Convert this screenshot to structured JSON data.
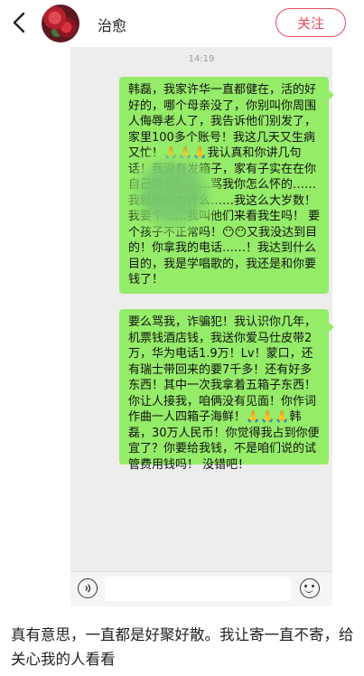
{
  "header": {
    "username": "治愈",
    "follow_label": "关注"
  },
  "chat": {
    "time": "14:19",
    "messages": [
      "韩磊，我家许华一直都健在，活的好好的，哪个母亲没了，你别叫你周围人侮辱老人了，我告诉他们别发了，家里100多个账号！我这几天又生病又忙！🙏🙏🙏我认真和你讲几句话！我没有发箱子，家有子实在在你自己听！！……骂我你怎么怀的……我就纳闷为什么……我这么大岁数！我要个……我叫他们来看我生吗！ 要个孩子不正常吗！😶😶又我没达到目的！你拿我的电话……！我达到什么目的，我是学唱歌的，我还是和你要钱了！",
      "要么骂我，诈骗犯！我认识你几年，机票钱酒店钱，我送你爱马仕皮带2万，华为电话1.9万！Lv！蒙口，还有瑞士带回来的要7千多！还有好多东西！其中一次我拿着五箱子东西！你让人接我，咱俩没有见面！你作词作曲一人四箱子海鲜！🙏🙏🙏韩磊，30万人民币！你觉得我占到你便宜了？你要给我钱，不是咱们说的试管费用钱吗！ 没错吧！"
    ]
  },
  "caption": "真有意思，一直都是好聚好散。我让寄一直不寄，给关心我的人看看"
}
